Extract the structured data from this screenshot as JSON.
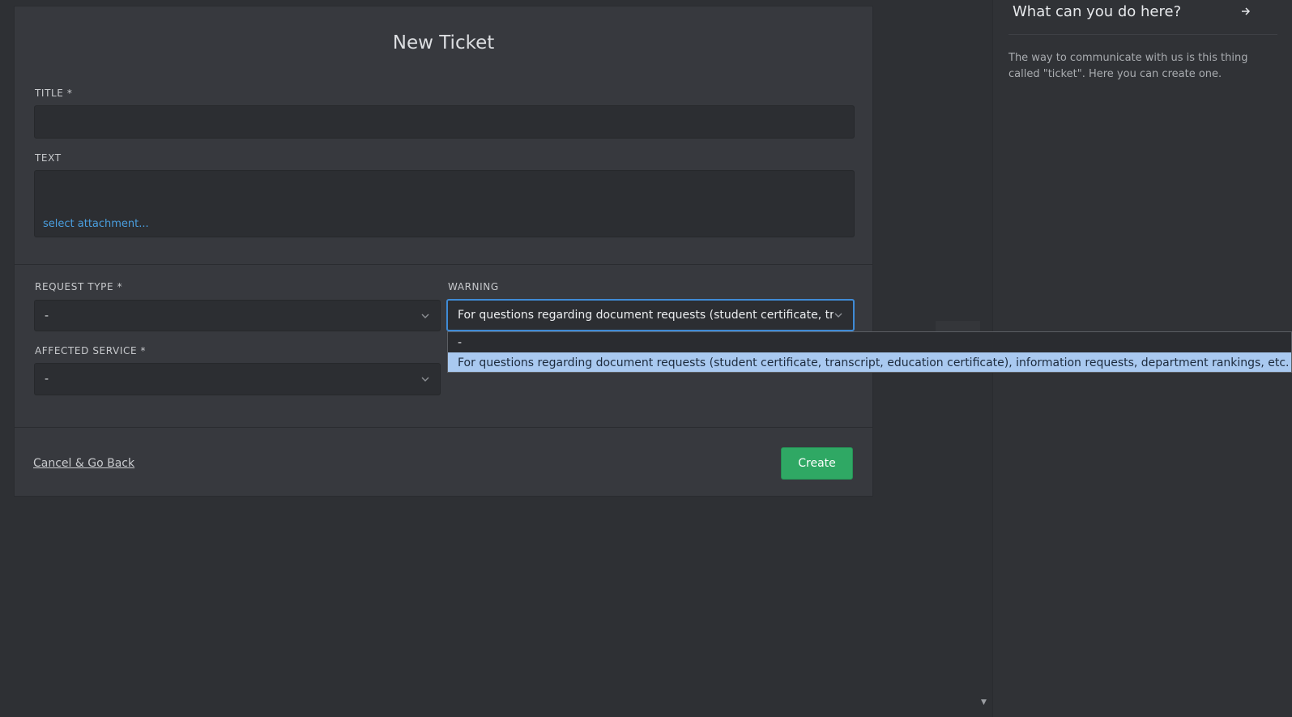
{
  "form": {
    "title": "New Ticket",
    "title_label": "TITLE *",
    "title_value": "",
    "text_label": "TEXT",
    "attachment_link": "select attachment...",
    "request_type_label": "REQUEST TYPE *",
    "request_type_value": "-",
    "affected_service_label": "AFFECTED SERVICE *",
    "affected_service_value": "-",
    "warning_label": "WARNING",
    "warning_value": "For questions regarding document requests (student certificate, transcript,",
    "cancel_link": "Cancel & Go Back",
    "create_button": "Create"
  },
  "dropdown": {
    "options": [
      "-",
      "For questions regarding document requests (student certificate, transcript, education certificate), information requests, department rankings, etc. that do not fall"
    ],
    "selected_index": 1
  },
  "side_panel": {
    "title": "What can you do here?",
    "text": "The way to communicate with us is this thing called \"ticket\". Here you can create one."
  },
  "icons": {
    "chevron": "chevron-down-icon",
    "arrow": "arrow-right-icon"
  }
}
